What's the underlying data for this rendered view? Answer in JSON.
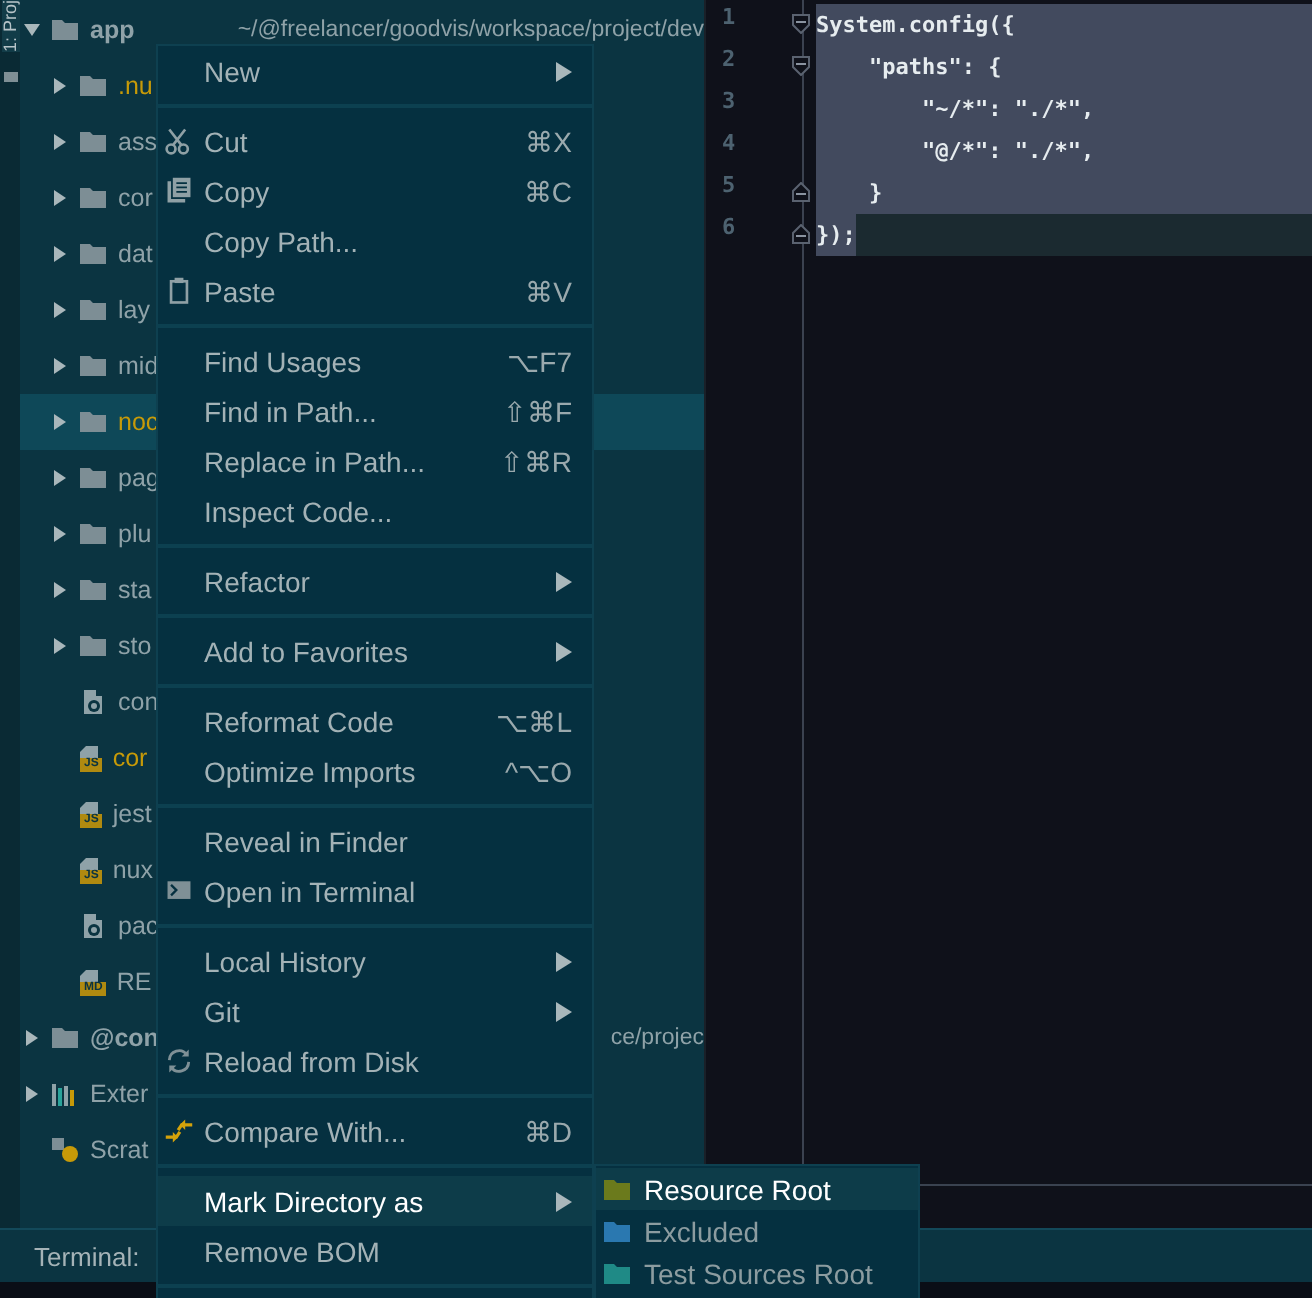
{
  "tool_strip": {
    "label": "1: Proj"
  },
  "tree": {
    "items": [
      {
        "kind": "folder",
        "name": "app",
        "path": "~/@freelancer/goodvis/workspace/project/dev",
        "expanded": true,
        "selected": false,
        "ignored": false,
        "children": [
          {
            "kind": "folder",
            "name": ".nu",
            "expanded": false,
            "selected": false,
            "ignored": true
          },
          {
            "kind": "folder",
            "name": "ass",
            "expanded": false,
            "selected": false,
            "ignored": false
          },
          {
            "kind": "folder",
            "name": "cor",
            "expanded": false,
            "selected": false,
            "ignored": false
          },
          {
            "kind": "folder",
            "name": "dat",
            "expanded": false,
            "selected": false,
            "ignored": false
          },
          {
            "kind": "folder",
            "name": "lay",
            "expanded": false,
            "selected": false,
            "ignored": false
          },
          {
            "kind": "folder",
            "name": "mid",
            "expanded": false,
            "selected": false,
            "ignored": false
          },
          {
            "kind": "folder",
            "name": "noc",
            "expanded": false,
            "selected": true,
            "ignored": true
          },
          {
            "kind": "folder",
            "name": "pag",
            "expanded": false,
            "selected": false,
            "ignored": false
          },
          {
            "kind": "folder",
            "name": "plu",
            "expanded": false,
            "selected": false,
            "ignored": false
          },
          {
            "kind": "folder",
            "name": "sta",
            "expanded": false,
            "selected": false,
            "ignored": false
          },
          {
            "kind": "folder",
            "name": "sto",
            "expanded": false,
            "selected": false,
            "ignored": false
          },
          {
            "kind": "config",
            "name": "con",
            "selected": false,
            "ignored": false
          },
          {
            "kind": "file",
            "name": "cor",
            "badge": "JS",
            "selected": false,
            "ignored": true
          },
          {
            "kind": "file",
            "name": "jest",
            "badge": "JS",
            "selected": false,
            "ignored": false
          },
          {
            "kind": "file",
            "name": "nux",
            "badge": "JS",
            "selected": false,
            "ignored": false
          },
          {
            "kind": "config",
            "name": "pac",
            "selected": false,
            "ignored": false
          },
          {
            "kind": "file",
            "name": "RE",
            "badge": "MD",
            "selected": false,
            "ignored": false
          }
        ]
      },
      {
        "kind": "folder",
        "name": "@con",
        "path": "ce/projec",
        "expanded": false,
        "selected": false,
        "ignored": false
      },
      {
        "kind": "library",
        "name": "Exter",
        "expanded": false,
        "selected": false,
        "ignored": false
      },
      {
        "kind": "scratch",
        "name": "Scrat",
        "selected": false,
        "ignored": false
      }
    ]
  },
  "editor": {
    "lines": [
      {
        "number": "1",
        "text": "System.config({",
        "fold_start": true,
        "fold_end": false,
        "selected": true,
        "current": false
      },
      {
        "number": "2",
        "text": "    \"paths\": {",
        "fold_start": true,
        "fold_end": false,
        "selected": true,
        "current": false
      },
      {
        "number": "3",
        "text": "        \"~/*\": \"./*\",",
        "fold_start": false,
        "fold_end": false,
        "selected": true,
        "current": false
      },
      {
        "number": "4",
        "text": "        \"@/*\": \"./*\",",
        "fold_start": false,
        "fold_end": false,
        "selected": true,
        "current": false
      },
      {
        "number": "5",
        "text": "    }",
        "fold_start": false,
        "fold_end": true,
        "selected": true,
        "current": false
      },
      {
        "number": "6",
        "text": "});",
        "fold_start": false,
        "fold_end": true,
        "selected": true,
        "current": true
      }
    ]
  },
  "context_menu": {
    "groups": [
      [
        {
          "label": "New",
          "submenu": true,
          "selected": false
        }
      ],
      [
        {
          "label": "Cut",
          "shortcut": "⌘X",
          "submenu": false,
          "selected": false
        },
        {
          "label": "Copy",
          "shortcut": "⌘C",
          "submenu": false,
          "selected": false
        },
        {
          "label": "Copy Path...",
          "submenu": false,
          "selected": false
        },
        {
          "label": "Paste",
          "shortcut": "⌘V",
          "submenu": false,
          "selected": false
        }
      ],
      [
        {
          "label": "Find Usages",
          "shortcut": "⌥F7",
          "submenu": false,
          "selected": false
        },
        {
          "label": "Find in Path...",
          "shortcut": "⇧⌘F",
          "submenu": false,
          "selected": false
        },
        {
          "label": "Replace in Path...",
          "shortcut": "⇧⌘R",
          "submenu": false,
          "selected": false
        },
        {
          "label": "Inspect Code...",
          "submenu": false,
          "selected": false
        }
      ],
      [
        {
          "label": "Refactor",
          "submenu": true,
          "selected": false
        }
      ],
      [
        {
          "label": "Add to Favorites",
          "submenu": true,
          "selected": false
        }
      ],
      [
        {
          "label": "Reformat Code",
          "shortcut": "⌥⌘L",
          "submenu": false,
          "selected": false
        },
        {
          "label": "Optimize Imports",
          "shortcut": "^⌥O",
          "submenu": false,
          "selected": false
        }
      ],
      [
        {
          "label": "Reveal in Finder",
          "submenu": false,
          "selected": false
        },
        {
          "label": "Open in Terminal",
          "submenu": false,
          "selected": false
        }
      ],
      [
        {
          "label": "Local History",
          "submenu": true,
          "selected": false
        },
        {
          "label": "Git",
          "submenu": true,
          "selected": false
        },
        {
          "label": "Reload from Disk",
          "submenu": false,
          "selected": false
        }
      ],
      [
        {
          "label": "Compare With...",
          "shortcut": "⌘D",
          "submenu": false,
          "selected": false
        }
      ],
      [
        {
          "label": "Mark Directory as",
          "submenu": true,
          "selected": true
        },
        {
          "label": "Remove BOM",
          "submenu": false,
          "selected": false
        }
      ]
    ]
  },
  "submenu": {
    "items": [
      {
        "label": "Resource Root",
        "color": "#6b7a1c",
        "selected": true
      },
      {
        "label": "Excluded",
        "color": "#2a78b0",
        "selected": false
      },
      {
        "label": "Test Sources Root",
        "color": "#1f8a86",
        "selected": false
      }
    ]
  },
  "terminal": {
    "label": "Terminal:"
  }
}
